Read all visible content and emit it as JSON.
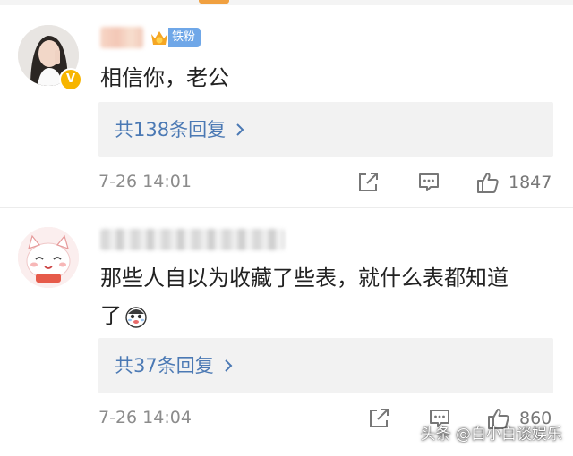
{
  "comments": [
    {
      "fan_badge": "铁粉",
      "verified_mark": "V",
      "text": "相信你，老公",
      "reply_link": "共138条回复",
      "timestamp": "7-26 14:01",
      "like_count": "1847"
    },
    {
      "text_line1": "那些人自以为收藏了些表，就什么表都知道",
      "text_line2": "了",
      "reply_link": "共37条回复",
      "timestamp": "7-26 14:04",
      "like_count": "860"
    }
  ],
  "icons": {
    "share": "share-icon",
    "comment": "comment-icon",
    "like": "thumbs-up-icon",
    "chevron": "chevron-right-icon"
  },
  "colors": {
    "link": "#4b79b4",
    "reply_bg": "#f2f2f2",
    "meta": "#8c8c8c",
    "fan_badge": "#6fa7e8",
    "verified": "#f7b500"
  },
  "watermark": "头条 @白小白谈娱乐"
}
